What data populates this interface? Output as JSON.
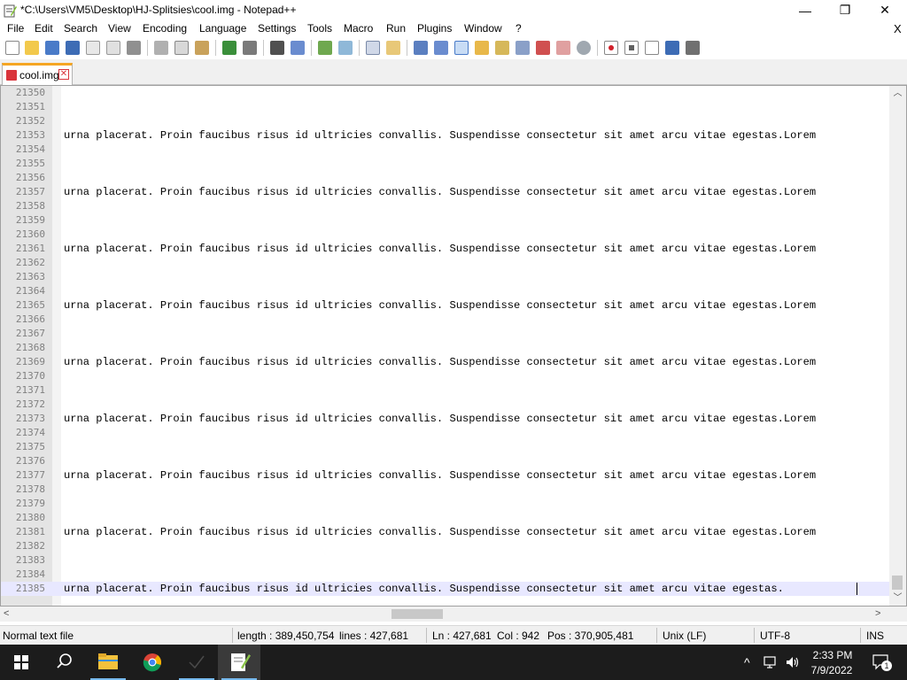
{
  "window": {
    "title": "*C:\\Users\\VM5\\Desktop\\HJ-Splitsies\\cool.img - Notepad++",
    "minimize_glyph": "—",
    "maximize_glyph": "❐",
    "close_glyph": "✕"
  },
  "menu": {
    "items": [
      "File",
      "Edit",
      "Search",
      "View",
      "Encoding",
      "Language",
      "Settings",
      "Tools",
      "Macro",
      "Run",
      "Plugins",
      "Window",
      "?"
    ],
    "close_doc_glyph": "X"
  },
  "toolbar": {
    "icons": [
      "new-file-icon",
      "open-file-icon",
      "save-icon",
      "save-all-icon",
      "close-icon",
      "close-all-icon",
      "print-icon",
      "cut-icon",
      "copy-icon",
      "paste-icon",
      "undo-icon",
      "redo-icon",
      "find-icon",
      "replace-icon",
      "zoom-in-icon",
      "zoom-out-icon",
      "sync-vertical-icon",
      "sync-horizontal-icon",
      "word-wrap-icon",
      "show-all-chars-icon",
      "indent-guide-icon",
      "doc-map-icon",
      "function-list-icon",
      "folder-workspace-icon",
      "monitoring-icon",
      "record-macro-icon",
      "stop-macro-icon",
      "play-macro-icon",
      "run-macro-multiple-icon",
      "save-macro-icon"
    ]
  },
  "tabs": [
    {
      "label": "cool.img",
      "close_glyph": "✕",
      "active": true
    }
  ],
  "editor": {
    "lines": [
      {
        "n": "21350",
        "t": ""
      },
      {
        "n": "21351",
        "t": ""
      },
      {
        "n": "21352",
        "t": ""
      },
      {
        "n": "21353",
        "t": "urna placerat. Proin faucibus risus id ultricies convallis. Suspendisse consectetur sit amet arcu vitae egestas.Lorem"
      },
      {
        "n": "21354",
        "t": ""
      },
      {
        "n": "21355",
        "t": ""
      },
      {
        "n": "21356",
        "t": ""
      },
      {
        "n": "21357",
        "t": "urna placerat. Proin faucibus risus id ultricies convallis. Suspendisse consectetur sit amet arcu vitae egestas.Lorem"
      },
      {
        "n": "21358",
        "t": ""
      },
      {
        "n": "21359",
        "t": ""
      },
      {
        "n": "21360",
        "t": ""
      },
      {
        "n": "21361",
        "t": "urna placerat. Proin faucibus risus id ultricies convallis. Suspendisse consectetur sit amet arcu vitae egestas.Lorem"
      },
      {
        "n": "21362",
        "t": ""
      },
      {
        "n": "21363",
        "t": ""
      },
      {
        "n": "21364",
        "t": ""
      },
      {
        "n": "21365",
        "t": "urna placerat. Proin faucibus risus id ultricies convallis. Suspendisse consectetur sit amet arcu vitae egestas.Lorem"
      },
      {
        "n": "21366",
        "t": ""
      },
      {
        "n": "21367",
        "t": ""
      },
      {
        "n": "21368",
        "t": ""
      },
      {
        "n": "21369",
        "t": "urna placerat. Proin faucibus risus id ultricies convallis. Suspendisse consectetur sit amet arcu vitae egestas.Lorem"
      },
      {
        "n": "21370",
        "t": ""
      },
      {
        "n": "21371",
        "t": ""
      },
      {
        "n": "21372",
        "t": ""
      },
      {
        "n": "21373",
        "t": "urna placerat. Proin faucibus risus id ultricies convallis. Suspendisse consectetur sit amet arcu vitae egestas.Lorem"
      },
      {
        "n": "21374",
        "t": ""
      },
      {
        "n": "21375",
        "t": ""
      },
      {
        "n": "21376",
        "t": ""
      },
      {
        "n": "21377",
        "t": "urna placerat. Proin faucibus risus id ultricies convallis. Suspendisse consectetur sit amet arcu vitae egestas.Lorem"
      },
      {
        "n": "21378",
        "t": ""
      },
      {
        "n": "21379",
        "t": ""
      },
      {
        "n": "21380",
        "t": ""
      },
      {
        "n": "21381",
        "t": "urna placerat. Proin faucibus risus id ultricies convallis. Suspendisse consectetur sit amet arcu vitae egestas.Lorem"
      },
      {
        "n": "21382",
        "t": ""
      },
      {
        "n": "21383",
        "t": ""
      },
      {
        "n": "21384",
        "t": ""
      },
      {
        "n": "21385",
        "t": "urna placerat. Proin faucibus risus id ultricies convallis. Suspendisse consectetur sit amet arcu vitae egestas.",
        "current": true
      }
    ]
  },
  "scrollbars": {
    "up_glyph": "︿",
    "down_glyph": "﹀",
    "left_glyph": "<",
    "right_glyph": ">"
  },
  "statusbar": {
    "file_type": "Normal text file",
    "length": "length : 389,450,754",
    "lines": "lines : 427,681",
    "ln": "Ln : 427,681",
    "col": "Col : 942",
    "pos": "Pos : 370,905,481",
    "eol": "Unix (LF)",
    "encoding": "UTF-8",
    "mode": "INS"
  },
  "taskbar": {
    "apps": [
      "start-icon",
      "search-icon",
      "file-explorer-icon",
      "chrome-icon",
      "checkmark-app-icon",
      "notepad-plus-plus-icon"
    ],
    "tray_chevron": "^",
    "time": "2:33 PM",
    "date": "7/9/2022",
    "notification_count": "1"
  },
  "colors": {
    "gutter_bg": "#e4e4e4",
    "current_line_bg": "#e8e8ff",
    "tab_accent": "#f5a623",
    "taskbar_bg": "#1c1c1c"
  }
}
